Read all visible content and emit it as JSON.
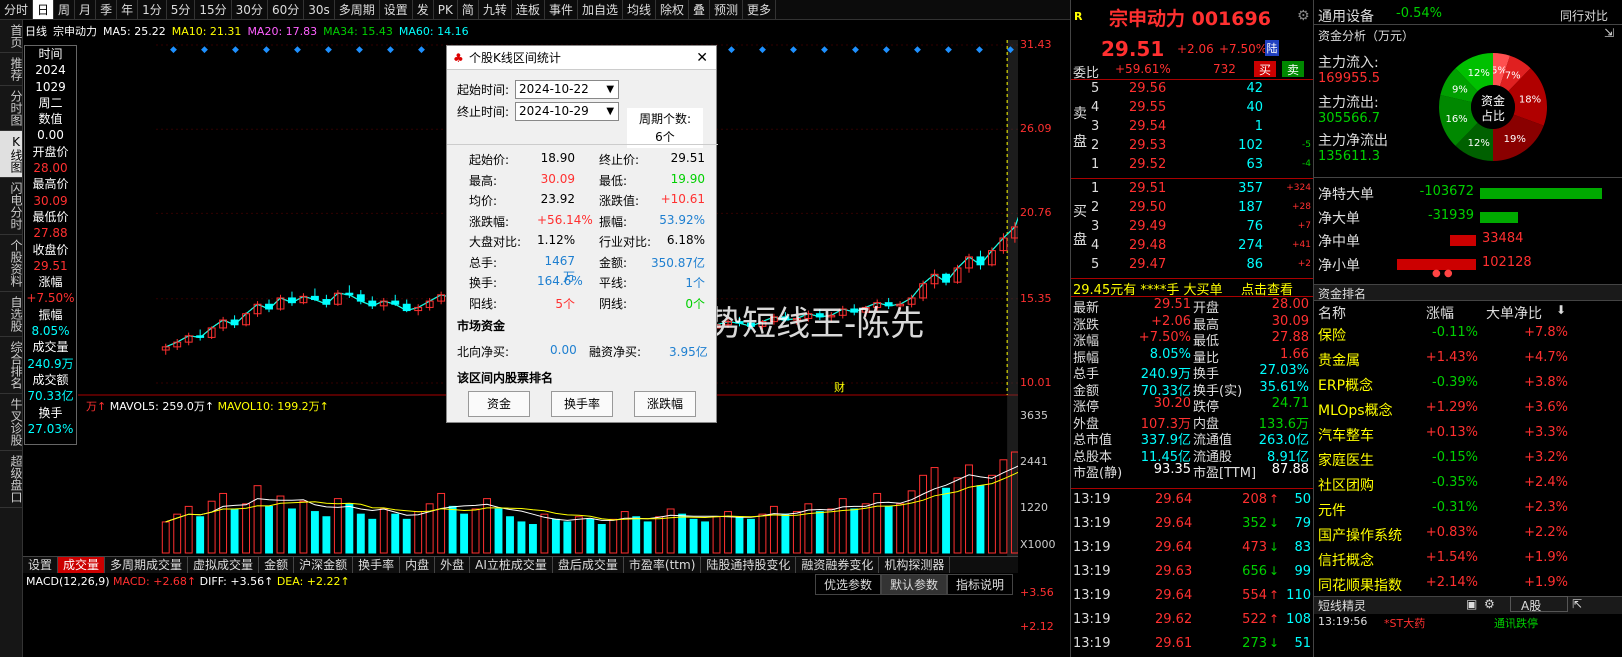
{
  "toolbar": {
    "items": [
      "分时",
      "日",
      "周",
      "月",
      "季",
      "年",
      "1分",
      "5分",
      "15分",
      "30分",
      "60分",
      "30s",
      "多周期",
      "设置",
      "发",
      "PK",
      "简",
      "九转",
      "连板",
      "事件",
      "加自选",
      "均线",
      "除权",
      "叠",
      "预测",
      "更多"
    ],
    "active": "日"
  },
  "leftnav": [
    "首页",
    "推荐",
    "分时图",
    "K线图",
    "闪电分时",
    "个股资料",
    "自选股",
    "综合排名",
    "牛叉诊股",
    "超级盘口"
  ],
  "leftnav_active": "K线图",
  "ma": {
    "name": "日线",
    "stock": "宗申动力",
    "ma5": "MA5: 25.22",
    "ma10": "MA10: 21.31",
    "ma20": "MA20: 17.83",
    "ma34": "MA34: 15.43",
    "ma60": "MA60: 14.16"
  },
  "info": [
    [
      "时间",
      "wht"
    ],
    [
      "2024",
      "wht"
    ],
    [
      "1029",
      "wht"
    ],
    [
      "周二",
      "wht"
    ],
    [
      "数值",
      "wht"
    ],
    [
      "0.00",
      "wht"
    ],
    [
      "开盘价",
      "wht"
    ],
    [
      "28.00",
      "red"
    ],
    [
      "最高价",
      "wht"
    ],
    [
      "30.09",
      "red"
    ],
    [
      "最低价",
      "wht"
    ],
    [
      "27.88",
      "red"
    ],
    [
      "收盘价",
      "wht"
    ],
    [
      "29.51",
      "red"
    ],
    [
      "涨幅",
      "wht"
    ],
    [
      "+7.50%",
      "red"
    ],
    [
      "振幅",
      "wht"
    ],
    [
      "8.05%",
      "cyn"
    ],
    [
      "成交量",
      "wht"
    ],
    [
      "240.9万",
      "cyn"
    ],
    [
      "成交额",
      "wht"
    ],
    [
      "70.33亿",
      "cyn"
    ],
    [
      "换手",
      "wht"
    ],
    [
      "27.03%",
      "cyn"
    ]
  ],
  "price_axis": [
    "31.43",
    "26.09",
    "20.76",
    "15.35",
    "10.01"
  ],
  "vol_axis": [
    "3635",
    "2441",
    "1220",
    "X1000"
  ],
  "macd_axis": [
    "+3.56",
    "+2.12"
  ],
  "chart_marks": {
    "high": "30.09",
    "low_mark": "q",
    "cai": "财",
    "bang": "榜"
  },
  "vol_legend": {
    "unit": "万↑",
    "mavol5": "MAVOL5: 259.0万↑",
    "mavol10": "MAVOL10: 199.2万↑"
  },
  "macd_legend": {
    "name": "MACD(12,26,9)",
    "macd": "MACD: +2.68↑",
    "diff": "DIFF: +3.56↑",
    "dea": "DEA: +2.22↑"
  },
  "macd_buttons": [
    "优选参数",
    "默认参数",
    "指标说明"
  ],
  "tabs": [
    "设置",
    "成交量",
    "多周期成交量",
    "虚拟成交量",
    "金额",
    "沪深金额",
    "换手率",
    "内盘",
    "外盘",
    "AI立桩成交量",
    "盘后成交量",
    "市盈率(ttm)",
    "陆股通持股变化",
    "融资融券变化",
    "机构探测器"
  ],
  "tabs_active": "成交量",
  "watermark": "@趋势短线王-陈先",
  "dialog": {
    "title": "个股K线区间统计",
    "start_label": "起始时间:",
    "start": "2024-10-22",
    "end_label": "终止时间:",
    "end": "2024-10-29",
    "period_label": "周期个数:",
    "period": "6个",
    "stats": [
      [
        "起始价:",
        "18.90",
        "wht",
        "终止价:",
        "29.51",
        "wht"
      ],
      [
        "最高:",
        "30.09",
        "red",
        "最低:",
        "19.90",
        "grn"
      ],
      [
        "均价:",
        "23.92",
        "wht",
        "涨跌值:",
        "+10.61",
        "red"
      ],
      [
        "涨跌幅:",
        "+56.14%",
        "red",
        "振幅:",
        "53.92%",
        "blu"
      ],
      [
        "大盘对比:",
        "1.12%",
        "wht",
        "行业对比:",
        "6.18%",
        "wht"
      ],
      [
        "总手:",
        "1467万",
        "blu",
        "金额:",
        "350.87亿",
        "blu"
      ],
      [
        "换手:",
        "164.6%",
        "blu",
        "平线:",
        "1个",
        "blu"
      ],
      [
        "阳线:",
        "5个",
        "red",
        "阴线:",
        "0个",
        "grn"
      ]
    ],
    "market_title": "市场资金",
    "north_label": "北向净买:",
    "north": "0.00",
    "margin_label": "融资净买:",
    "margin": "3.95亿",
    "rank_title": "该区间内股票排名",
    "buttons": [
      "资金",
      "换手率",
      "涨跌幅"
    ]
  },
  "quote": {
    "name": "宗申动力 001696",
    "price": "29.51",
    "chg": "+2.06",
    "pct": "+7.50%",
    "lu": "陆",
    "weibi_label": "委比",
    "weibi": "+59.61%",
    "weicha": "732",
    "buy": "买",
    "sell": "卖",
    "asks": [
      [
        "5",
        "29.56",
        "42",
        ""
      ],
      [
        "4",
        "29.55",
        "40",
        ""
      ],
      [
        "3",
        "29.54",
        "1",
        ""
      ],
      [
        "2",
        "29.53",
        "102",
        "-5"
      ],
      [
        "1",
        "29.52",
        "63",
        "-4"
      ]
    ],
    "bids": [
      [
        "1",
        "29.51",
        "357",
        "+324"
      ],
      [
        "2",
        "29.50",
        "187",
        "+28"
      ],
      [
        "3",
        "29.49",
        "76",
        "+7"
      ],
      [
        "4",
        "29.48",
        "274",
        "+41"
      ],
      [
        "5",
        "29.47",
        "86",
        "+2"
      ]
    ],
    "big": "29.45元有 ****手 大买单",
    "click": "点击查看",
    "stats": [
      [
        "最新",
        "29.51",
        "red",
        "开盘",
        "28.00",
        "red"
      ],
      [
        "涨跌",
        "+2.06",
        "red",
        "最高",
        "30.09",
        "red"
      ],
      [
        "涨幅",
        "+7.50%",
        "red",
        "最低",
        "27.88",
        "red"
      ],
      [
        "振幅",
        "8.05%",
        "cyn",
        "量比",
        "1.66",
        "red"
      ],
      [
        "总手",
        "240.9万",
        "cyn",
        "换手",
        "27.03%",
        "cyn"
      ],
      [
        "金额",
        "70.33亿",
        "cyn",
        "换手(实)",
        "35.61%",
        "cyn"
      ],
      [
        "涨停",
        "30.20",
        "red",
        "跌停",
        "24.71",
        "grn"
      ],
      [
        "外盘",
        "107.3万",
        "red",
        "内盘",
        "133.6万",
        "grn"
      ],
      [
        "总市值",
        "337.9亿",
        "cyn",
        "流通值",
        "263.0亿",
        "cyn"
      ],
      [
        "总股本",
        "11.45亿",
        "cyn",
        "流通股",
        "8.91亿",
        "cyn"
      ],
      [
        "市盈(静)",
        "93.35",
        "wht",
        "市盈[TTM]",
        "87.88",
        "wht"
      ]
    ],
    "ticks": [
      [
        "13:19",
        "29.64",
        "208",
        "red",
        "↑",
        "50"
      ],
      [
        "13:19",
        "29.64",
        "352",
        "grn",
        "↓",
        "79"
      ],
      [
        "13:19",
        "29.64",
        "473",
        "red",
        "↓",
        "83"
      ],
      [
        "13:19",
        "29.63",
        "656",
        "grn",
        "↓",
        "99"
      ],
      [
        "13:19",
        "29.64",
        "554",
        "red",
        "↑",
        "110"
      ],
      [
        "13:19",
        "29.62",
        "522",
        "red",
        "↑",
        "108"
      ],
      [
        "13:19",
        "29.61",
        "273",
        "grn",
        "↓",
        "51"
      ]
    ]
  },
  "right": {
    "sector": "通用设备",
    "sector_pct": "-0.54%",
    "peer": "同行对比",
    "flow_title": "资金分析（万元）",
    "inflow_label": "主力流入:",
    "inflow": "169955.5",
    "outflow_label": "主力流出:",
    "outflow": "305566.7",
    "net_label": "主力净流出",
    "net": "135611.3",
    "donut_center": "资金占比",
    "donut": [
      {
        "v": 5,
        "c": "#ff5050",
        "l": "5%"
      },
      {
        "v": 7,
        "c": "#e02020",
        "l": "7%"
      },
      {
        "v": 18,
        "c": "#b00000",
        "l": "18%"
      },
      {
        "v": 19,
        "c": "#8a0000",
        "l": "19%"
      },
      {
        "v": 12,
        "c": "#006000",
        "l": "12%"
      },
      {
        "v": 16,
        "c": "#008800",
        "l": "16%"
      },
      {
        "v": 9,
        "c": "#00a000",
        "l": "9%"
      },
      {
        "v": 12,
        "c": "#00c000",
        "l": "12%"
      }
    ],
    "bars": [
      [
        "净特大单",
        "-103672",
        "grn",
        0.9
      ],
      [
        "净大单",
        "-31939",
        "grn",
        0.28
      ],
      [
        "净中单",
        "33484",
        "red",
        0.29
      ],
      [
        "净小单",
        "102128",
        "red",
        0.88
      ]
    ],
    "rank_title": "资金排名",
    "rank_head": [
      "名称",
      "涨幅",
      "大单净比"
    ],
    "rank": [
      [
        "保险",
        "-0.11%",
        "grn",
        "+7.8%"
      ],
      [
        "贵金属",
        "+1.43%",
        "red",
        "+4.7%"
      ],
      [
        "ERP概念",
        "-0.39%",
        "grn",
        "+3.8%"
      ],
      [
        "MLOps概念",
        "+1.29%",
        "red",
        "+3.6%"
      ],
      [
        "汽车整车",
        "+0.13%",
        "red",
        "+3.3%"
      ],
      [
        "家庭医生",
        "-0.15%",
        "grn",
        "+3.2%"
      ],
      [
        "社区团购",
        "-0.35%",
        "grn",
        "+2.4%"
      ],
      [
        "元件",
        "-0.31%",
        "grn",
        "+2.3%"
      ],
      [
        "国产操作系统",
        "+0.83%",
        "red",
        "+2.2%"
      ],
      [
        "信托概念",
        "+1.54%",
        "red",
        "+1.9%"
      ],
      [
        "同花顺果指数",
        "+2.14%",
        "red",
        "+1.9%"
      ]
    ],
    "sprite_title": "短线精灵",
    "sprite_sel": "A股",
    "sprite": [
      [
        "13:19:56",
        "*ST大药",
        "通讯跌停"
      ]
    ]
  },
  "chart_data": {
    "type": "candlestick",
    "period": "daily",
    "ylim": [
      10.01,
      31.43
    ],
    "candles": [
      [
        12.1,
        12.5,
        11.8,
        12.3
      ],
      [
        12.3,
        12.8,
        12.1,
        12.6
      ],
      [
        12.6,
        13.2,
        12.4,
        13.0
      ],
      [
        13.0,
        13.4,
        12.7,
        12.9
      ],
      [
        12.9,
        13.6,
        12.8,
        13.5
      ],
      [
        13.5,
        14.2,
        13.3,
        14.0
      ],
      [
        14.0,
        14.3,
        13.5,
        13.7
      ],
      [
        13.7,
        14.5,
        13.6,
        14.4
      ],
      [
        14.4,
        15.2,
        14.2,
        15.0
      ],
      [
        15.0,
        15.3,
        14.5,
        14.7
      ],
      [
        14.7,
        15.6,
        14.6,
        15.4
      ],
      [
        15.4,
        15.8,
        14.9,
        15.1
      ],
      [
        15.1,
        15.7,
        15.0,
        15.5
      ],
      [
        15.5,
        16.0,
        15.2,
        15.3
      ],
      [
        15.3,
        15.6,
        14.8,
        15.0
      ],
      [
        15.0,
        15.9,
        14.9,
        15.7
      ],
      [
        15.7,
        16.2,
        15.4,
        15.6
      ],
      [
        15.6,
        15.9,
        15.0,
        15.2
      ],
      [
        15.2,
        15.5,
        14.7,
        14.9
      ],
      [
        14.9,
        15.4,
        14.6,
        15.2
      ],
      [
        15.2,
        15.6,
        14.9,
        15.0
      ],
      [
        15.0,
        15.3,
        14.5,
        14.6
      ],
      [
        14.6,
        15.0,
        14.3,
        14.8
      ],
      [
        14.8,
        15.4,
        14.6,
        15.2
      ],
      [
        15.2,
        15.8,
        15.0,
        15.6
      ],
      [
        15.6,
        16.1,
        15.3,
        15.4
      ],
      [
        15.4,
        15.7,
        14.9,
        15.1
      ],
      [
        15.1,
        15.5,
        14.8,
        15.3
      ],
      [
        15.3,
        15.9,
        15.1,
        15.7
      ],
      [
        15.7,
        16.0,
        15.2,
        15.4
      ],
      [
        15.4,
        15.6,
        14.8,
        14.9
      ],
      [
        14.9,
        15.2,
        14.4,
        14.6
      ],
      [
        14.6,
        14.9,
        14.0,
        14.2
      ],
      [
        14.2,
        14.6,
        13.8,
        14.4
      ],
      [
        14.4,
        14.8,
        14.0,
        14.1
      ],
      [
        14.1,
        14.3,
        13.6,
        13.8
      ],
      [
        13.8,
        14.2,
        13.5,
        14.0
      ],
      [
        14.0,
        14.4,
        13.7,
        13.9
      ],
      [
        13.9,
        14.1,
        13.4,
        13.6
      ],
      [
        13.6,
        14.0,
        13.3,
        13.8
      ],
      [
        13.8,
        14.3,
        13.6,
        14.1
      ],
      [
        14.1,
        14.5,
        13.8,
        14.0
      ],
      [
        14.0,
        14.2,
        13.5,
        13.7
      ],
      [
        13.7,
        14.1,
        13.4,
        13.9
      ],
      [
        13.9,
        14.3,
        13.7,
        14.2
      ],
      [
        14.2,
        14.6,
        13.9,
        14.0
      ],
      [
        14.0,
        14.3,
        13.6,
        13.8
      ],
      [
        13.8,
        14.0,
        13.3,
        13.5
      ],
      [
        13.5,
        13.9,
        13.2,
        13.7
      ],
      [
        13.7,
        14.1,
        13.5,
        13.9
      ],
      [
        13.9,
        14.2,
        13.6,
        13.8
      ],
      [
        13.8,
        14.0,
        13.4,
        13.6
      ],
      [
        13.6,
        14.0,
        13.4,
        13.9
      ],
      [
        13.9,
        14.4,
        13.7,
        14.2
      ],
      [
        14.2,
        14.5,
        13.9,
        14.0
      ],
      [
        14.0,
        14.3,
        13.7,
        14.1
      ],
      [
        14.1,
        14.6,
        13.9,
        14.4
      ],
      [
        14.4,
        14.7,
        14.0,
        14.2
      ],
      [
        14.2,
        14.5,
        13.9,
        14.3
      ],
      [
        14.3,
        14.9,
        14.1,
        14.7
      ],
      [
        14.7,
        15.0,
        14.3,
        14.5
      ],
      [
        14.5,
        14.9,
        14.2,
        14.8
      ],
      [
        14.8,
        15.3,
        14.6,
        15.1
      ],
      [
        15.1,
        15.4,
        14.7,
        14.9
      ],
      [
        14.9,
        15.2,
        14.6,
        15.0
      ],
      [
        15.0,
        15.6,
        14.8,
        15.4
      ],
      [
        15.4,
        16.5,
        15.2,
        16.3
      ],
      [
        16.3,
        17.2,
        16.0,
        16.9
      ],
      [
        16.9,
        17.0,
        16.2,
        16.4
      ],
      [
        16.4,
        17.5,
        16.3,
        17.3
      ],
      [
        17.3,
        18.2,
        17.0,
        18.0
      ],
      [
        18.0,
        18.4,
        17.2,
        17.5
      ],
      [
        17.5,
        18.6,
        17.4,
        18.4
      ],
      [
        18.4,
        19.5,
        18.2,
        19.2
      ],
      [
        19.2,
        20.2,
        18.9,
        19.9
      ],
      [
        18.9,
        21.9,
        18.9,
        21.9
      ],
      [
        21.9,
        24.1,
        21.5,
        24.1
      ],
      [
        24.1,
        26.5,
        23.8,
        26.5
      ],
      [
        26.5,
        28.0,
        25.5,
        27.45
      ],
      [
        28.0,
        30.09,
        27.88,
        29.51
      ]
    ],
    "volumes": [
      120,
      150,
      180,
      140,
      200,
      230,
      170,
      190,
      260,
      180,
      220,
      170,
      200,
      160,
      140,
      210,
      190,
      150,
      130,
      170,
      150,
      130,
      160,
      190,
      230,
      180,
      150,
      170,
      210,
      170,
      140,
      120,
      110,
      150,
      130,
      120,
      140,
      130,
      110,
      130,
      160,
      140,
      120,
      140,
      170,
      150,
      130,
      120,
      140,
      160,
      140,
      130,
      150,
      180,
      150,
      160,
      190,
      160,
      170,
      210,
      170,
      190,
      230,
      180,
      190,
      240,
      300,
      330,
      250,
      290,
      340,
      260,
      300,
      360,
      390,
      450,
      520,
      560,
      420,
      410
    ],
    "macd": {
      "diff": 3.56,
      "dea": 2.22,
      "macd": 2.68
    }
  }
}
